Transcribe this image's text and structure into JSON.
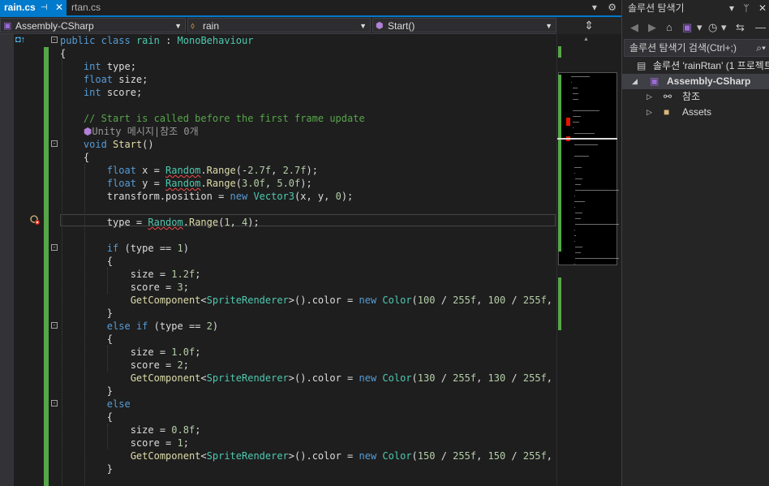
{
  "tabs": [
    {
      "label": "rain.cs",
      "active": true,
      "pin": "⊣",
      "close": "✕"
    },
    {
      "label": "rtan.cs",
      "active": false
    }
  ],
  "tab_tools": {
    "dropdown": "▾",
    "settings": "⚙"
  },
  "nav": {
    "project": "Assembly-CSharp",
    "class": "rain",
    "member": "Start()"
  },
  "code_lines": [
    "public class rain : MonoBehaviour",
    "{",
    "    int type;",
    "    float size;",
    "    int score;",
    "",
    "    // Start is called before the first frame update",
    "    Unity 메시지|참조 0개",
    "    void Start()",
    "    {",
    "        float x = Random.Range(-2.7f, 2.7f);",
    "        float y = Random.Range(3.0f, 5.0f);",
    "        transform.position = new Vector3(x, y, 0);",
    "",
    "        type = Random.Range(1, 4);",
    "",
    "        if (type == 1)",
    "        {",
    "            size = 1.2f;",
    "            score = 3;",
    "            GetComponent<SpriteRenderer>().color = new Color(100 / 255f, 100 / 255f, 255",
    "        }",
    "        else if (type == 2)",
    "        {",
    "            size = 1.0f;",
    "            score = 2;",
    "            GetComponent<SpriteRenderer>().color = new Color(130 / 255f, 130 / 255f, 255",
    "        }",
    "        else",
    "        {",
    "            size = 0.8f;",
    "            score = 1;",
    "            GetComponent<SpriteRenderer>().color = new Color(150 / 255f, 150 / 255f, 255",
    "        }"
  ],
  "solution_explorer": {
    "title": "솔루션 탐색기",
    "search_placeholder": "솔루션 탐색기 검색(Ctrl+;)",
    "solution": "솔루션 'rainRtan' (1 프로젝트",
    "project": "Assembly-CSharp",
    "references": "참조",
    "assets": "Assets"
  }
}
